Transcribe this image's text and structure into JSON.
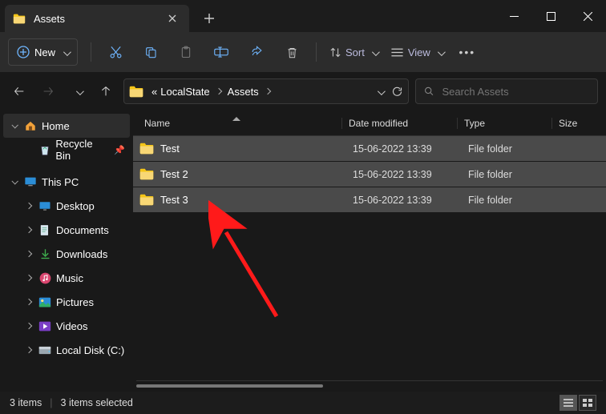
{
  "tab": {
    "title": "Assets"
  },
  "toolbar": {
    "new_label": "New",
    "sort_label": "Sort",
    "view_label": "View"
  },
  "breadcrumb": {
    "prefix": "«",
    "segments": [
      "LocalState",
      "Assets"
    ]
  },
  "search": {
    "placeholder": "Search Assets"
  },
  "sidebar": {
    "home": "Home",
    "recycle": "Recycle Bin",
    "thispc": "This PC",
    "items": [
      {
        "label": "Desktop"
      },
      {
        "label": "Documents"
      },
      {
        "label": "Downloads"
      },
      {
        "label": "Music"
      },
      {
        "label": "Pictures"
      },
      {
        "label": "Videos"
      },
      {
        "label": "Local Disk (C:)"
      }
    ]
  },
  "columns": {
    "name": "Name",
    "date": "Date modified",
    "type": "Type",
    "size": "Size"
  },
  "rows": [
    {
      "name": "Test",
      "date": "15-06-2022 13:39",
      "type": "File folder"
    },
    {
      "name": "Test 2",
      "date": "15-06-2022 13:39",
      "type": "File folder"
    },
    {
      "name": "Test 3",
      "date": "15-06-2022 13:39",
      "type": "File folder"
    }
  ],
  "status": {
    "count": "3 items",
    "selected": "3 items selected"
  }
}
